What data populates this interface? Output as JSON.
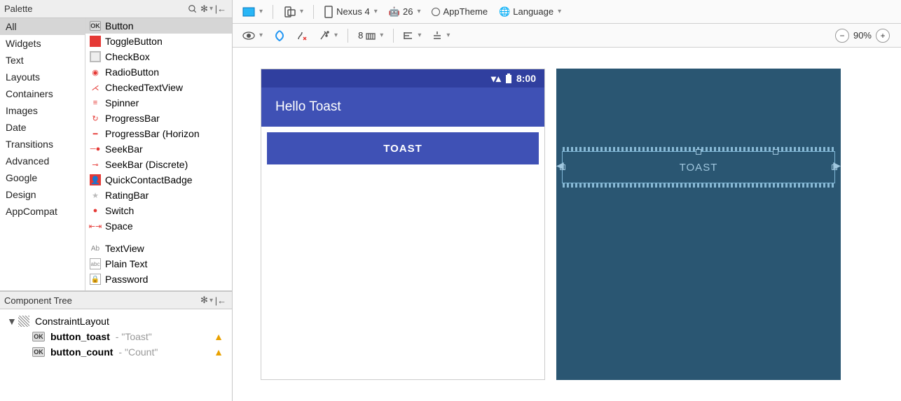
{
  "palette": {
    "title": "Palette",
    "categories": [
      "All",
      "Widgets",
      "Text",
      "Layouts",
      "Containers",
      "Images",
      "Date",
      "Transitions",
      "Advanced",
      "Google",
      "Design",
      "AppCompat"
    ],
    "selected_category": "All",
    "widgets_group1": [
      "Button",
      "ToggleButton",
      "CheckBox",
      "RadioButton",
      "CheckedTextView",
      "Spinner",
      "ProgressBar",
      "ProgressBar (Horizon",
      "SeekBar",
      "SeekBar (Discrete)",
      "QuickContactBadge",
      "RatingBar",
      "Switch",
      "Space"
    ],
    "widgets_group2": [
      "TextView",
      "Plain Text",
      "Password"
    ],
    "selected_widget": "Button"
  },
  "component_tree": {
    "title": "Component Tree",
    "root": "ConstraintLayout",
    "items": [
      {
        "id": "button_toast",
        "text": "Toast",
        "warn": true
      },
      {
        "id": "button_count",
        "text": "Count",
        "warn": true
      }
    ]
  },
  "top_toolbar": {
    "device": "Nexus 4",
    "api": "26",
    "theme": "AppTheme",
    "locale": "Language"
  },
  "design_toolbar": {
    "autoconnect_value": "8"
  },
  "zoom": {
    "value": "90%"
  },
  "preview": {
    "time": "8:00",
    "app_title": "Hello Toast",
    "toast_button": "TOAST"
  },
  "blueprint": {
    "toast_button": "TOAST"
  },
  "colors": {
    "primary": "#3F51B5",
    "primary_dark": "#303F9F",
    "blueprint_bg": "#2a5672"
  },
  "ok_badge": "OK",
  "minus": "−",
  "plus": "+",
  "hyphen": " - "
}
